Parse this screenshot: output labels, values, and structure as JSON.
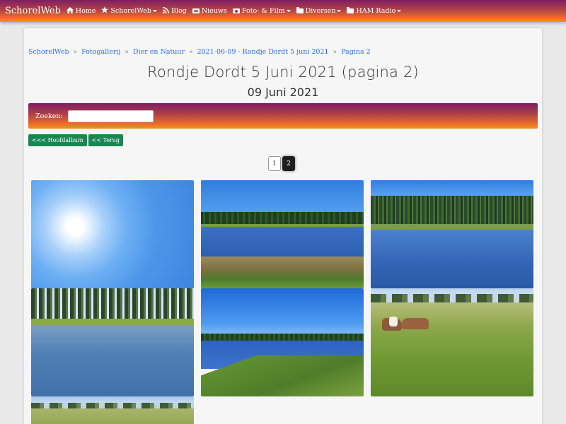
{
  "navbar": {
    "brand": "SchorelWeb",
    "items": [
      {
        "label": "Home",
        "icon": "home-icon",
        "dropdown": false
      },
      {
        "label": "SchorelWeb",
        "icon": "star-icon",
        "dropdown": true
      },
      {
        "label": "Blog",
        "icon": "rss-icon",
        "dropdown": false
      },
      {
        "label": "Nieuws",
        "icon": "newspaper-icon",
        "dropdown": false
      },
      {
        "label": "Foto- & Film",
        "icon": "camera-icon",
        "dropdown": true
      },
      {
        "label": "Diversen",
        "icon": "folder-icon",
        "dropdown": true
      },
      {
        "label": "HAM Radio",
        "icon": "folder-icon",
        "dropdown": true
      }
    ]
  },
  "breadcrumb": [
    "SchorelWeb",
    "Fotogallerij",
    "Dier en Natuur",
    "2021-06-09 - Rondje Dordt 5 juni 2021",
    "Pagina 2"
  ],
  "breadcrumb_separator": "»",
  "title": "Rondje Dordt 5 Juni 2021 (pagina 2)",
  "subtitle": "09 Juni 2021",
  "search": {
    "label": "Zoeken:",
    "value": "",
    "placeholder": ""
  },
  "buttons": {
    "main_album": "<<< Hoofdalbum",
    "back": "<< Terug"
  },
  "pagination": {
    "pages": [
      "1",
      "2"
    ],
    "current": "2"
  },
  "photos": [
    {
      "subject": "sun-in-sky"
    },
    {
      "subject": "lake-with-tree-line-and-shore"
    },
    {
      "subject": "lake-with-tree-line"
    },
    {
      "subject": "lake-with-tall-poplars-and-swan"
    },
    {
      "subject": "lake-with-grassy-bank"
    },
    {
      "subject": "horses-in-tall-grass"
    },
    {
      "subject": "meadow-partial"
    }
  ],
  "colors": {
    "accent_green": "#198754",
    "link_blue": "#2a6fd6",
    "gradient_top": "#7d1e63",
    "gradient_bottom": "#f4901c"
  }
}
